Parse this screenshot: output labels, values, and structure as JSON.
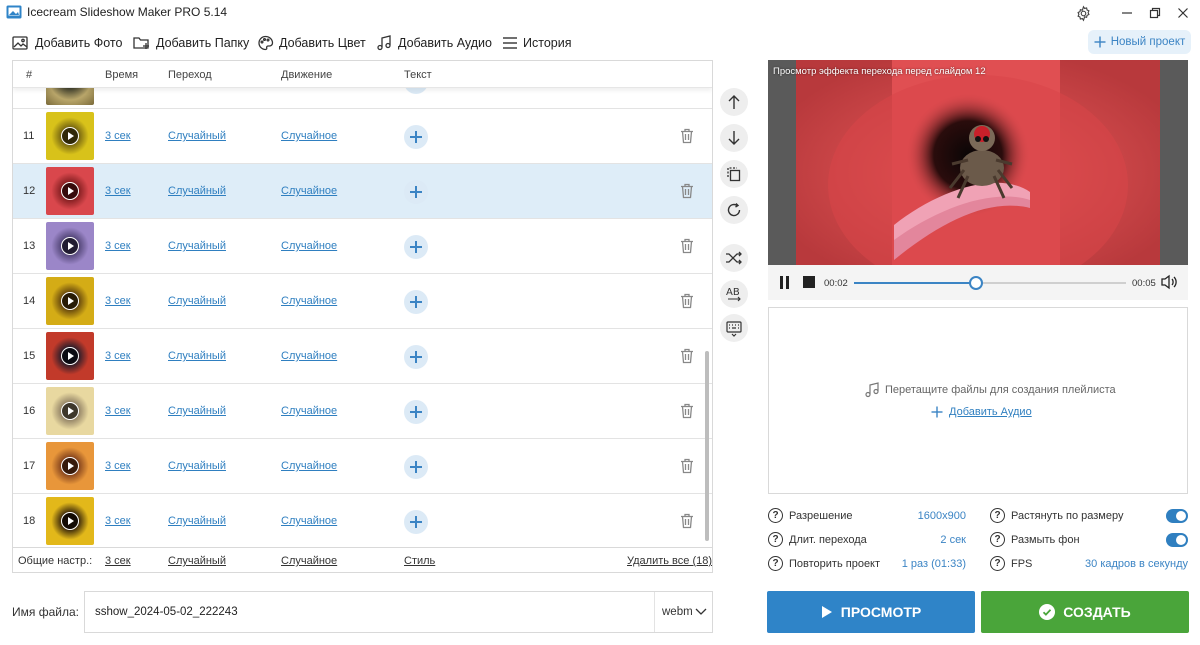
{
  "window": {
    "title": "Icecream Slideshow Maker PRO 5.14"
  },
  "toolbar": {
    "add_photo": "Добавить Фото",
    "add_folder": "Добавить Папку",
    "add_color": "Добавить Цвет",
    "add_audio": "Добавить Аудио",
    "history": "История",
    "new_project": "Новый проект"
  },
  "table": {
    "columns": [
      "#",
      "Время",
      "Переход",
      "Движение",
      "Текст"
    ],
    "rows": [
      {
        "num": "11",
        "time": "3 сек",
        "transition": "Случайный",
        "motion": "Случайное",
        "thumb": "#d8c21a",
        "thumb_center": "#6a5a10",
        "selected": false
      },
      {
        "num": "12",
        "time": "3 сек",
        "transition": "Случайный",
        "motion": "Случайное",
        "thumb": "#d9474c",
        "thumb_center": "#7a1a1c",
        "selected": true
      },
      {
        "num": "13",
        "time": "3 сек",
        "transition": "Случайный",
        "motion": "Случайное",
        "thumb": "#9b86c8",
        "thumb_center": "#4a3e6e",
        "selected": false
      },
      {
        "num": "14",
        "time": "3 сек",
        "transition": "Случайный",
        "motion": "Случайное",
        "thumb": "#d4ac16",
        "thumb_center": "#5a3c0c",
        "selected": false
      },
      {
        "num": "15",
        "time": "3 сек",
        "transition": "Случайный",
        "motion": "Случайное",
        "thumb": "#c23a2a",
        "thumb_center": "#1a1a2a",
        "selected": false
      },
      {
        "num": "16",
        "time": "3 сек",
        "transition": "Случайный",
        "motion": "Случайное",
        "thumb": "#e8d8a0",
        "thumb_center": "#8a7a60",
        "selected": false
      },
      {
        "num": "17",
        "time": "3 сек",
        "transition": "Случайный",
        "motion": "Случайное",
        "thumb": "#e8963a",
        "thumb_center": "#7a3a1a",
        "selected": false
      },
      {
        "num": "18",
        "time": "3 сек",
        "transition": "Случайный",
        "motion": "Случайное",
        "thumb": "#e2b81a",
        "thumb_center": "#2a1a0a",
        "selected": false
      }
    ],
    "footer": {
      "label": "Общие настр.:",
      "time": "3 сек",
      "transition": "Случайный",
      "motion": "Случайное",
      "style": "Стиль",
      "delete_all": "Удалить все (18)"
    }
  },
  "filename": {
    "label": "Имя файла:",
    "value": "sshow_2024-05-02_222243",
    "format": "webm"
  },
  "preview": {
    "title": "Просмотр эффекта перехода перед слайдом 12",
    "current_time": "00:02",
    "total_time": "00:05",
    "progress": 0.45
  },
  "playlist": {
    "hint": "Перетащите файлы для создания плейлиста",
    "add_audio": "Добавить Аудио"
  },
  "settings": {
    "resolution_label": "Разрешение",
    "resolution_value": "1600x900",
    "transition_duration_label": "Длит. перехода",
    "transition_duration_value": "2 сек",
    "repeat_label": "Повторить проект",
    "repeat_value": "1 раз (01:33)",
    "stretch_label": "Растянуть по размеру",
    "stretch_on": true,
    "blur_label": "Размыть фон",
    "blur_on": true,
    "fps_label": "FPS",
    "fps_value": "30 кадров в секунду"
  },
  "actions": {
    "preview": "ПРОСМОТР",
    "create": "СОЗДАТЬ"
  },
  "colors": {
    "accent": "#2f84c8",
    "create": "#4aa53a",
    "selected_row": "#deedf8"
  }
}
